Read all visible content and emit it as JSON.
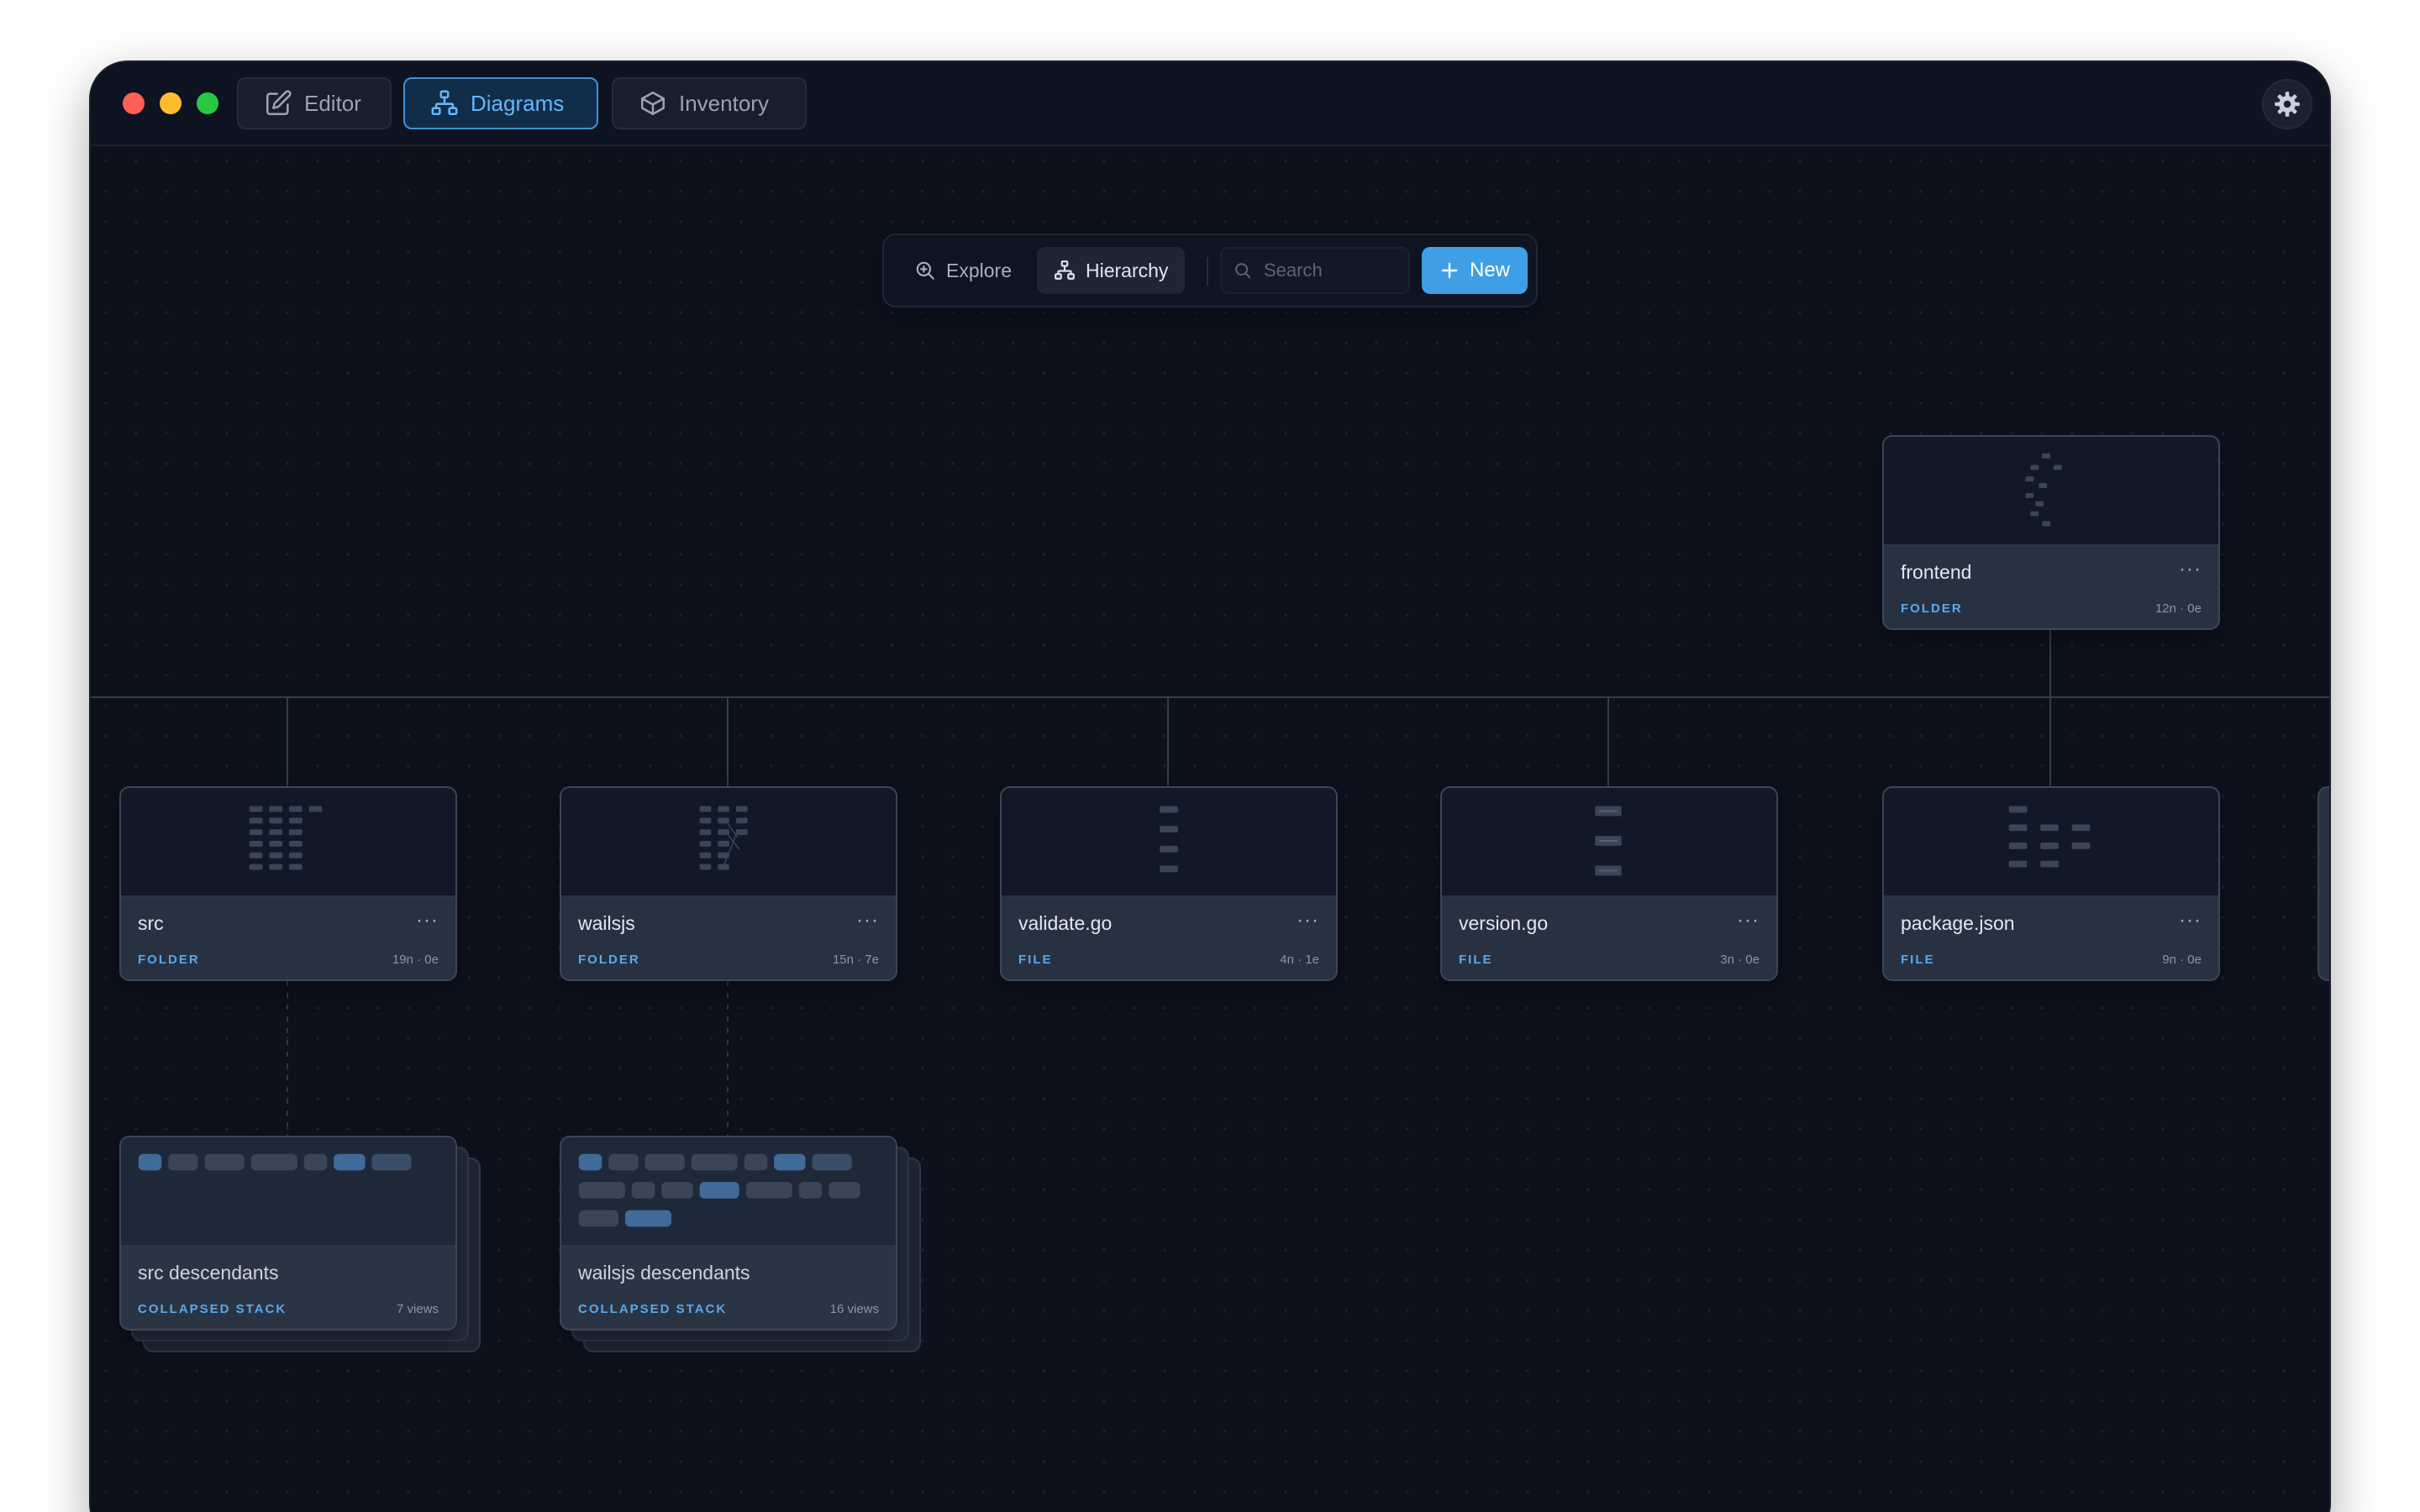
{
  "window": {
    "tabs": [
      {
        "label": "Editor",
        "icon": "edit-icon",
        "active": false
      },
      {
        "label": "Diagrams",
        "icon": "hierarchy-icon",
        "active": true
      },
      {
        "label": "Inventory",
        "icon": "box-icon",
        "active": false
      }
    ],
    "settings_icon": "gear-icon"
  },
  "toolbar": {
    "explore_label": "Explore",
    "hierarchy_label": "Hierarchy",
    "search_placeholder": "Search",
    "new_label": "New"
  },
  "root": {
    "name": "frontend",
    "kind": "FOLDER",
    "meta": "12n · 0e"
  },
  "children": [
    {
      "name": "src",
      "kind": "FOLDER",
      "meta": "19n · 0e"
    },
    {
      "name": "wailsjs",
      "kind": "FOLDER",
      "meta": "15n · 7e"
    },
    {
      "name": "validate.go",
      "kind": "FILE",
      "meta": "4n · 1e"
    },
    {
      "name": "version.go",
      "kind": "FILE",
      "meta": "3n · 0e"
    },
    {
      "name": "package.json",
      "kind": "FILE",
      "meta": "9n · 0e"
    }
  ],
  "stacks": [
    {
      "name": "src descendants",
      "kind": "COLLAPSED STACK",
      "meta": "7 views"
    },
    {
      "name": "wailsjs descendants",
      "kind": "COLLAPSED STACK",
      "meta": "16 views"
    }
  ],
  "card_more_label": "···",
  "colors": {
    "accent": "#3f9fe6",
    "active_tab_text": "#66b6f5",
    "canvas": "#0c111c",
    "card": "#273142",
    "kind_label": "#5ba8ea"
  }
}
